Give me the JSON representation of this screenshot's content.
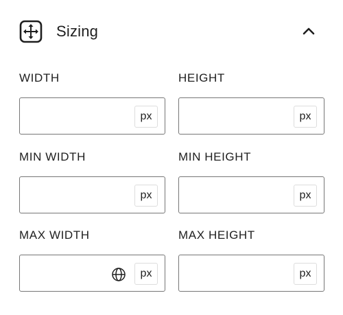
{
  "panel": {
    "title": "Sizing",
    "icon": "resize-move-icon",
    "collapse_icon": "chevron-up-icon"
  },
  "fields": {
    "width": {
      "label": "WIDTH",
      "value": "",
      "unit": "px"
    },
    "height": {
      "label": "HEIGHT",
      "value": "",
      "unit": "px"
    },
    "min_width": {
      "label": "MIN WIDTH",
      "value": "",
      "unit": "px"
    },
    "min_height": {
      "label": "MIN HEIGHT",
      "value": "",
      "unit": "px"
    },
    "max_width": {
      "label": "MAX WIDTH",
      "value": "",
      "unit": "px",
      "extra_icon": "globe-icon"
    },
    "max_height": {
      "label": "MAX HEIGHT",
      "value": "",
      "unit": "px"
    }
  }
}
